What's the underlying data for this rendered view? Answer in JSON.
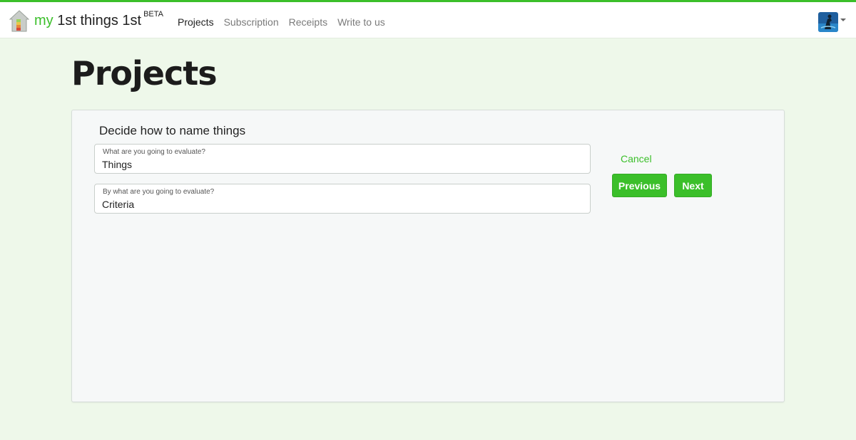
{
  "app": {
    "brand_prefix": "my",
    "brand_name": "1st things 1st",
    "brand_badge": "BETA",
    "logo_icon": "house-icon",
    "accent_color": "#3bbf2a"
  },
  "nav": {
    "items": [
      {
        "label": "Projects",
        "active": true
      },
      {
        "label": "Subscription",
        "active": false
      },
      {
        "label": "Receipts",
        "active": false
      },
      {
        "label": "Write to us",
        "active": false
      }
    ]
  },
  "user_menu": {
    "avatar_icon": "user-avatar",
    "dropdown_icon": "caret-down-icon"
  },
  "page": {
    "title": "Projects"
  },
  "wizard": {
    "heading": "Decide how to name things",
    "fields": [
      {
        "label": "What are you going to evaluate?",
        "value": "Things"
      },
      {
        "label": "By what are you going to evaluate?",
        "value": "Criteria"
      }
    ],
    "cancel_label": "Cancel",
    "previous_label": "Previous",
    "next_label": "Next"
  }
}
